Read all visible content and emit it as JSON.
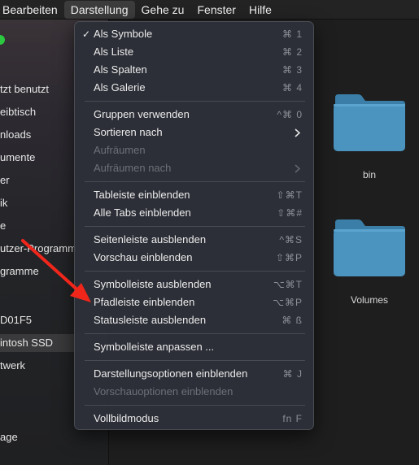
{
  "menubar": {
    "items": [
      "Bearbeiten",
      "Darstellung",
      "Gehe zu",
      "Fenster",
      "Hilfe"
    ],
    "active": "Darstellung"
  },
  "sidebar": {
    "items": [
      "tzt benutzt",
      "eibtisch",
      "nloads",
      "umente",
      "er",
      "ik",
      "e",
      "utzer-Programm",
      "gramme",
      "D01F5",
      "intosh SSD",
      "twerk",
      "age"
    ],
    "selected_index": 10
  },
  "content": {
    "folders": [
      {
        "label": "bin",
        "icon": "folder-icon"
      },
      {
        "label": "Volumes",
        "icon": "folder-icon"
      }
    ]
  },
  "view_menu": {
    "check_glyph": "✓",
    "items": [
      {
        "label": "Als Symbole",
        "shortcut": "⌘ 1",
        "checked": true
      },
      {
        "label": "Als Liste",
        "shortcut": "⌘ 2"
      },
      {
        "label": "Als Spalten",
        "shortcut": "⌘ 3"
      },
      {
        "label": "Als Galerie",
        "shortcut": "⌘ 4"
      },
      {
        "label": "Gruppen verwenden",
        "shortcut": "^⌘ 0"
      },
      {
        "label": "Sortieren nach",
        "submenu": true
      },
      {
        "label": "Aufräumen",
        "disabled": true
      },
      {
        "label": "Aufräumen nach",
        "disabled": true,
        "submenu": true
      },
      {
        "label": "Tableiste einblenden",
        "shortcut": "⇧⌘T"
      },
      {
        "label": "Alle Tabs einblenden",
        "shortcut": "⇧⌘#"
      },
      {
        "label": "Seitenleiste ausblenden",
        "shortcut": "^⌘S"
      },
      {
        "label": "Vorschau einblenden",
        "shortcut": "⇧⌘P"
      },
      {
        "label": "Symbolleiste ausblenden",
        "shortcut": "⌥⌘T"
      },
      {
        "label": "Pfadleiste einblenden",
        "shortcut": "⌥⌘P"
      },
      {
        "label": "Statusleiste ausblenden",
        "shortcut": "⌘ ß"
      },
      {
        "label": "Symbolleiste anpassen ..."
      },
      {
        "label": "Darstellungsoptionen einblenden",
        "shortcut": "⌘ J"
      },
      {
        "label": "Vorschauoptionen einblenden",
        "disabled": true
      },
      {
        "label": "Vollbildmodus",
        "shortcut": "fn F"
      }
    ]
  },
  "colors": {
    "folder_body": "#4a94bf",
    "folder_tab": "#3b7fa8",
    "arrow": "#f0261b",
    "traffic_green": "#2bc840"
  }
}
